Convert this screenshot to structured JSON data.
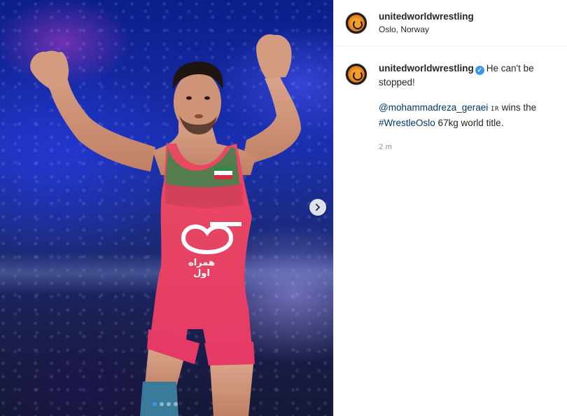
{
  "post": {
    "username": "unitedworldwrestling",
    "location": "Oslo, Norway",
    "caption": {
      "username": "unitedworldwrestling",
      "line1": "He can't be stopped!",
      "mention": "@mohammadreza_geraei",
      "flag_code": "IR",
      "mid_text": " wins the ",
      "hashtag": "#WrestleOslo",
      "end_text": " 67kg world title."
    },
    "timestamp": "2 m"
  },
  "singlet": {
    "logo_script": "همراه اول"
  },
  "carousel": {
    "slides": 4,
    "active_index": 0
  },
  "colors": {
    "verified": "#3897f0",
    "link": "#00376b",
    "singlet": "#e8385a",
    "stage_blue": "#1a2fb0"
  },
  "icons": {
    "next": "chevron-right-icon",
    "verified": "verified-badge-icon",
    "avatar": "uww-logo-icon"
  }
}
